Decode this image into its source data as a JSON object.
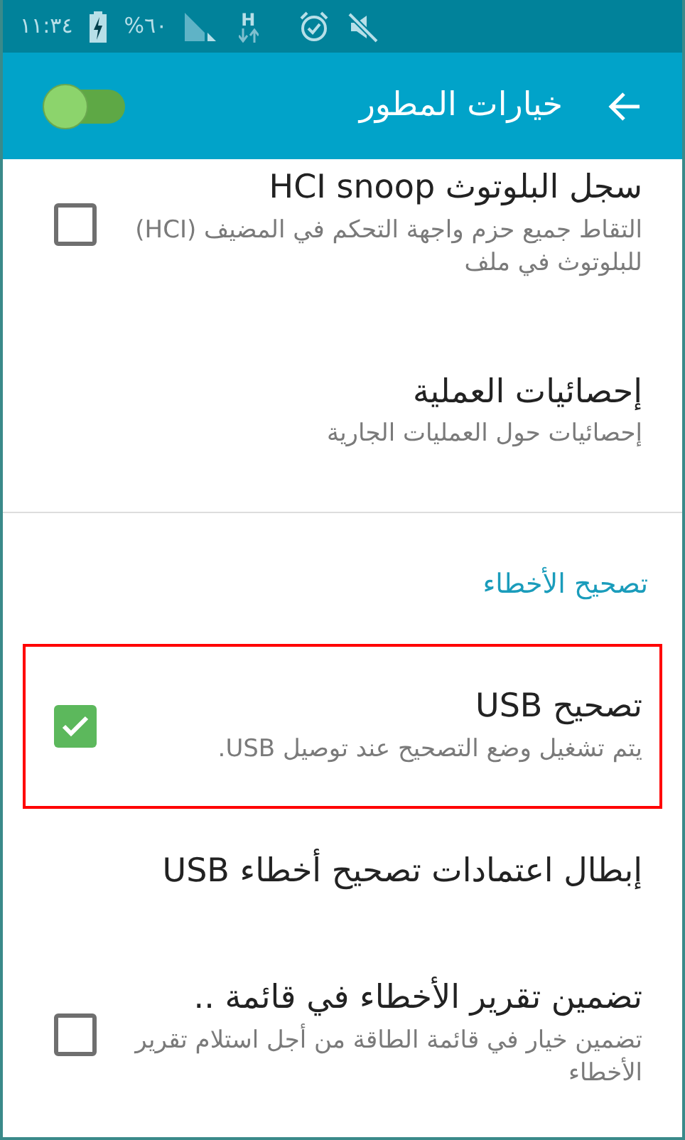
{
  "status_bar": {
    "time": "١١:٣٤",
    "battery": "%٦٠",
    "network": "H"
  },
  "header": {
    "title": "خيارات المطور",
    "toggle_on": true
  },
  "items": [
    {
      "kind": "checkbox",
      "title": "سجل البلوتوث HCI snoop",
      "subtitle": "التقاط جميع حزم واجهة التحكم في المضيف (HCI) للبلوتوث في ملف",
      "checked": false,
      "highlighted": false
    },
    {
      "kind": "plain",
      "title": "إحصائيات العملية",
      "subtitle": "إحصائيات حول العمليات الجارية",
      "highlighted": false
    },
    {
      "kind": "divider"
    },
    {
      "kind": "section",
      "title": "تصحيح الأخطاء"
    },
    {
      "kind": "checkbox",
      "title": "تصحيح USB",
      "subtitle": "يتم تشغيل وضع التصحيح عند توصيل USB.",
      "checked": true,
      "highlighted": true
    },
    {
      "kind": "plain",
      "title": "إبطال اعتمادات تصحيح أخطاء USB",
      "highlighted": false
    },
    {
      "kind": "checkbox",
      "title": "تضمين تقرير الأخطاء في قائمة ..",
      "subtitle": "تضمين خيار في قائمة الطاقة من أجل استلام تقرير الأخطاء",
      "checked": false,
      "highlighted": false
    }
  ]
}
